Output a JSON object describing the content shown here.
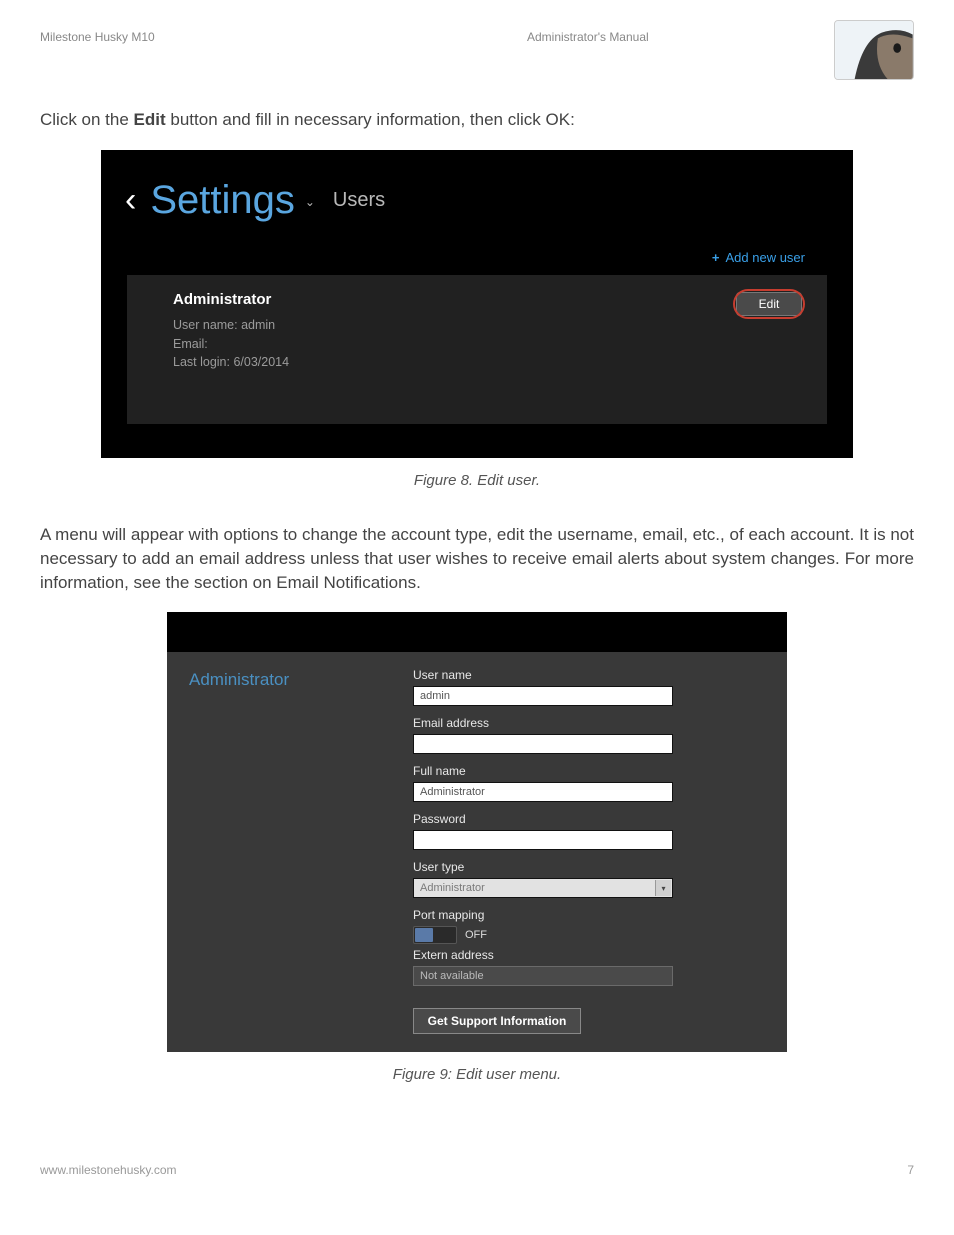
{
  "doc": {
    "header_left": "Milestone Husky M10",
    "header_center": "Administrator's Manual",
    "intro_before_bold": "Click on the ",
    "intro_bold": "Edit",
    "intro_after_bold": " button and fill in necessary information, then click OK:",
    "caption1": "Figure 8. Edit user.",
    "para2": "A menu will appear with options to change the account type, edit the username, email, etc., of each account. It is not necessary to add an email address unless that user wishes to receive email alerts about system changes. For more information, see the section on Email Notifications.",
    "caption2": "Figure 9: Edit user menu.",
    "footer_left": "www.milestonehusky.com",
    "footer_right": "7"
  },
  "shot1": {
    "title": "Settings",
    "subtitle": "Users",
    "add_new_user": "Add new user",
    "user": {
      "display_name": "Administrator",
      "username_line": "User name: admin",
      "email_line": "Email:",
      "last_login_line": "Last login: 6/03/2014"
    },
    "edit_label": "Edit"
  },
  "shot2": {
    "heading": "Administrator",
    "labels": {
      "username": "User name",
      "email": "Email address",
      "fullname": "Full name",
      "password": "Password",
      "usertype": "User type",
      "portmapping": "Port mapping",
      "externaddr": "Extern address"
    },
    "values": {
      "username": "admin",
      "email": "",
      "fullname": "Administrator",
      "password": "",
      "usertype": "Administrator",
      "portmapping_state": "OFF",
      "externaddr": "Not available"
    },
    "support_btn": "Get Support Information"
  }
}
